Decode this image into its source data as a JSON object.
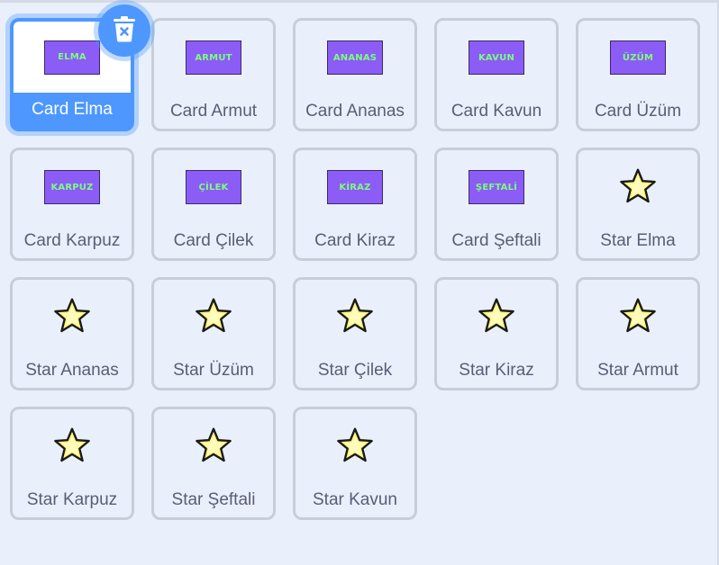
{
  "sprites": [
    {
      "label": "Card Elma",
      "kind": "card",
      "card_text": "ELMA",
      "selected": true
    },
    {
      "label": "Card Armut",
      "kind": "card",
      "card_text": "ARMUT"
    },
    {
      "label": "Card Ananas",
      "kind": "card",
      "card_text": "ANANAS"
    },
    {
      "label": "Card Kavun",
      "kind": "card",
      "card_text": "KAVUN"
    },
    {
      "label": "Card Üzüm",
      "kind": "card",
      "card_text": "ÜZÜM"
    },
    {
      "label": "Card Karpuz",
      "kind": "card",
      "card_text": "KARPUZ"
    },
    {
      "label": "Card Çilek",
      "kind": "card",
      "card_text": "ÇİLEK"
    },
    {
      "label": "Card Kiraz",
      "kind": "card",
      "card_text": "KİRAZ"
    },
    {
      "label": "Card Şeftali",
      "kind": "card",
      "card_text": "ŞEFTALİ"
    },
    {
      "label": "Star Elma",
      "kind": "star"
    },
    {
      "label": "Star Ananas",
      "kind": "star"
    },
    {
      "label": "Star Üzüm",
      "kind": "star"
    },
    {
      "label": "Star Çilek",
      "kind": "star"
    },
    {
      "label": "Star Kiraz",
      "kind": "star"
    },
    {
      "label": "Star Armut",
      "kind": "star"
    },
    {
      "label": "Star Karpuz",
      "kind": "star"
    },
    {
      "label": "Star Şeftali",
      "kind": "star"
    },
    {
      "label": "Star Kavun",
      "kind": "star"
    }
  ],
  "delete_button_icon": "trash-icon",
  "colors": {
    "background": "#e9f0fb",
    "tile_border": "#c7ced9",
    "selected_accent": "#4d97ff",
    "label_text": "#575e75",
    "card_fill": "#8b5cf6",
    "card_text": "#7dff7a",
    "star_fill": "#fff66b"
  }
}
